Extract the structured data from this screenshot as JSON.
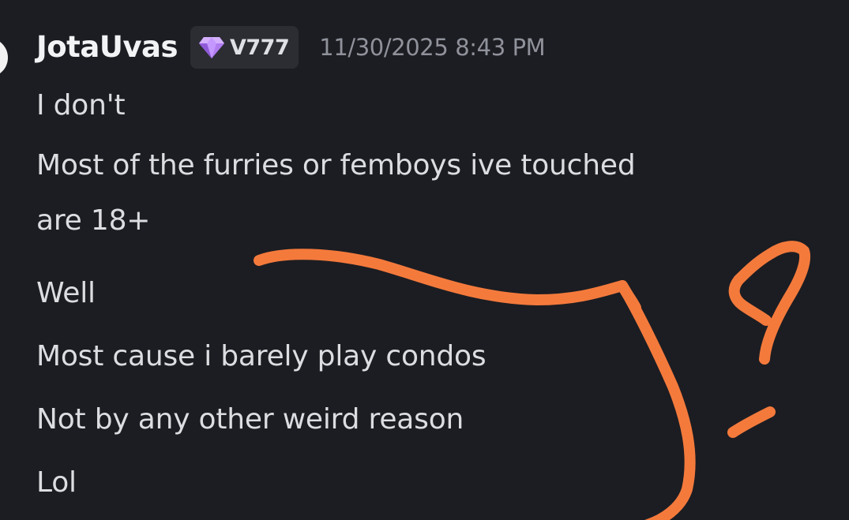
{
  "message": {
    "author": "JotaUvas",
    "tag": {
      "icon": "gem-icon",
      "label": "V777",
      "icon_color": "#b07cf0"
    },
    "timestamp": "11/30/2025 8:43 PM",
    "lines": [
      "I don't",
      "Most of the furries or femboys ive touched",
      "are 18+",
      "Well",
      "Most cause i barely play condos",
      "Not by any other weird reason",
      "Lol"
    ]
  },
  "annotation": {
    "color": "#f47a3c",
    "drawing": "hand-drawn-question-mark"
  },
  "colors": {
    "background": "#1c1d22",
    "username": "#f2f3f5",
    "message_text": "#dcdde1",
    "timestamp": "#90929b",
    "badge_bg": "#2b2d33"
  }
}
